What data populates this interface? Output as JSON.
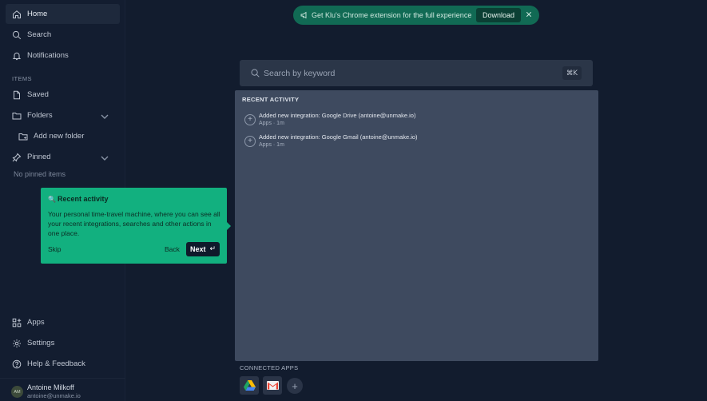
{
  "sidebar": {
    "home": "Home",
    "search": "Search",
    "notifications": "Notifications",
    "items_label": "ITEMS",
    "saved": "Saved",
    "folders": "Folders",
    "add_folder": "Add new folder",
    "pinned": "Pinned",
    "no_pinned": "No pinned items",
    "apps": "Apps",
    "settings": "Settings",
    "help": "Help & Feedback",
    "user": {
      "initials": "AM",
      "name": "Antoine Milkoff",
      "email": "antoine@unmake.io"
    }
  },
  "banner": {
    "text": "Get Klu's Chrome extension for the full experience",
    "download": "Download",
    "icon": "megaphone-icon"
  },
  "search": {
    "placeholder": "Search by keyword",
    "shortcut": "⌘K"
  },
  "recent": {
    "title": "RECENT ACTIVITY",
    "items": [
      {
        "title": "Added new integration: Google Drive (antoine@unmake.io)",
        "meta": "Apps · 1m"
      },
      {
        "title": "Added new integration: Google Gmail (antoine@unmake.io)",
        "meta": "Apps · 1m"
      }
    ]
  },
  "connected": {
    "label": "CONNECTED APPS",
    "apps": [
      "google-drive-icon",
      "gmail-icon"
    ]
  },
  "tour": {
    "emoji": "🔍",
    "title": "Recent activity",
    "body": "Your personal time-travel machine, where you can see all your recent integrations, searches and other actions in one place.",
    "skip": "Skip",
    "back": "Back",
    "next": "Next",
    "next_icon": "↵"
  },
  "colors": {
    "accent": "#12b07f",
    "background": "#121c2e",
    "panel": "#3e4a5f"
  }
}
